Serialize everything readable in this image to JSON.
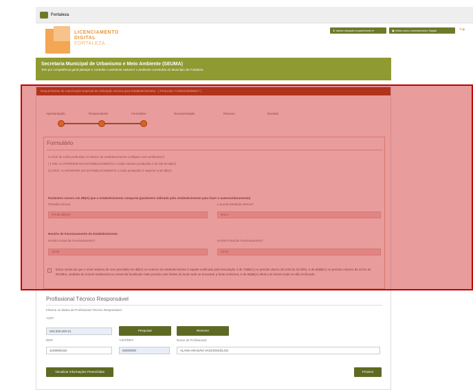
{
  "topbar": {
    "brand": "Fortaleza"
  },
  "header": {
    "logo_line1": "LICENCIAMENTO",
    "logo_line2": "DIGITAL",
    "logo_line3": "FORTALEZA",
    "btn_primary": "⬇ alterar situação requerimento ▾",
    "btn_secondary": "▣ Visão como Licenciamento Digital",
    "icon": "exit-icon"
  },
  "banner": {
    "title": "Secretaria Municipal de Urbanismo e Meio Ambiente (SEUMA)",
    "subtitle": "Tem por competência geral planejar e controlar o ambiente natural e o ambiente construído do Município de Fortaleza."
  },
  "panel": {
    "heading": "Requerimento de Autorização Especial de Utilização Sonora para Estabelecimentos - [ Protocolo: FAB20220005817 ]"
  },
  "steps": [
    {
      "label": "Apresentação"
    },
    {
      "label": "Responsáveis"
    },
    {
      "label": "Formulário"
    },
    {
      "label": "Documentação"
    },
    {
      "label": "Resumo"
    },
    {
      "label": "Enviado"
    }
  ],
  "form": {
    "title": "Formulário",
    "question": "O nível de ruído produzido no interior do estabelecimento configura som ambiente(?)",
    "option1": "( ) SIM, no INTERIOR DO ESTABELECIMENTO o ruído máximo produzido é de até 60 dB(A)",
    "option2": "(x) NÃO, no INTERIOR DO ESTABELECIMENTO o ruído produzido é superior a 60 dB(A)",
    "section_sound": "Parâmetro sonoro em dB(A) que o estabelecimento comporta (parâmetro utilizado pelo estabelecimento para fazer o automonitoramento)",
    "pressure_label": "Pressão Sonora",
    "pressure_value": "(70,00 dB(A))",
    "local_label": "Local de Medição Interna?",
    "local_value": "SALA",
    "section_hours": "Horário de Funcionamento do Estabelecimento",
    "start_label": "Horário Inicial de Funcionamento?",
    "start_value": "10:00",
    "end_label": "Horário Final de Funcionamento?",
    "end_value": "22:00",
    "declaration": "Estou ciente de que o nível máximo de som permitido em dB(A) no exterior do estabelecimento é aquele verificado pela Resolução 4 de 70dB(A) no período diurno de 6:00 às 22:00hs, e de 60dB(A) no período noturno de 22:01 às 05:59hs, medidos do imóvel residencial ou comercial localizado mais próximo dos limites do local onde se encontrar a fonte emissora, e de 55dB(A) dentro do imóvel onde se dão incômodo."
  },
  "responsible": {
    "title": "Profissional Técnico Responsável",
    "info": "Informe os dados do Profissional Técnico Responsável",
    "cpf_label": "*CPF:",
    "cpf_value": "000.000.000-01",
    "search_btn": "Pesquisar",
    "remove_btn": "Remover",
    "rnp_label": "RNP:",
    "rnp_value": "4100000418",
    "art_label": "*ART/RRT:",
    "art_value": "00000000",
    "name_label": "Nome do Profissional:",
    "name_value": "ALANA ARAGÃO VASCONCELOS",
    "view_btn": "Visualizar Informações Preenchidas",
    "next_btn": "Próximo"
  },
  "colors": {
    "accent": "#6d7a2a",
    "banner": "#8f9a33",
    "panel_head": "#a04a22",
    "highlight": "#c00000"
  }
}
